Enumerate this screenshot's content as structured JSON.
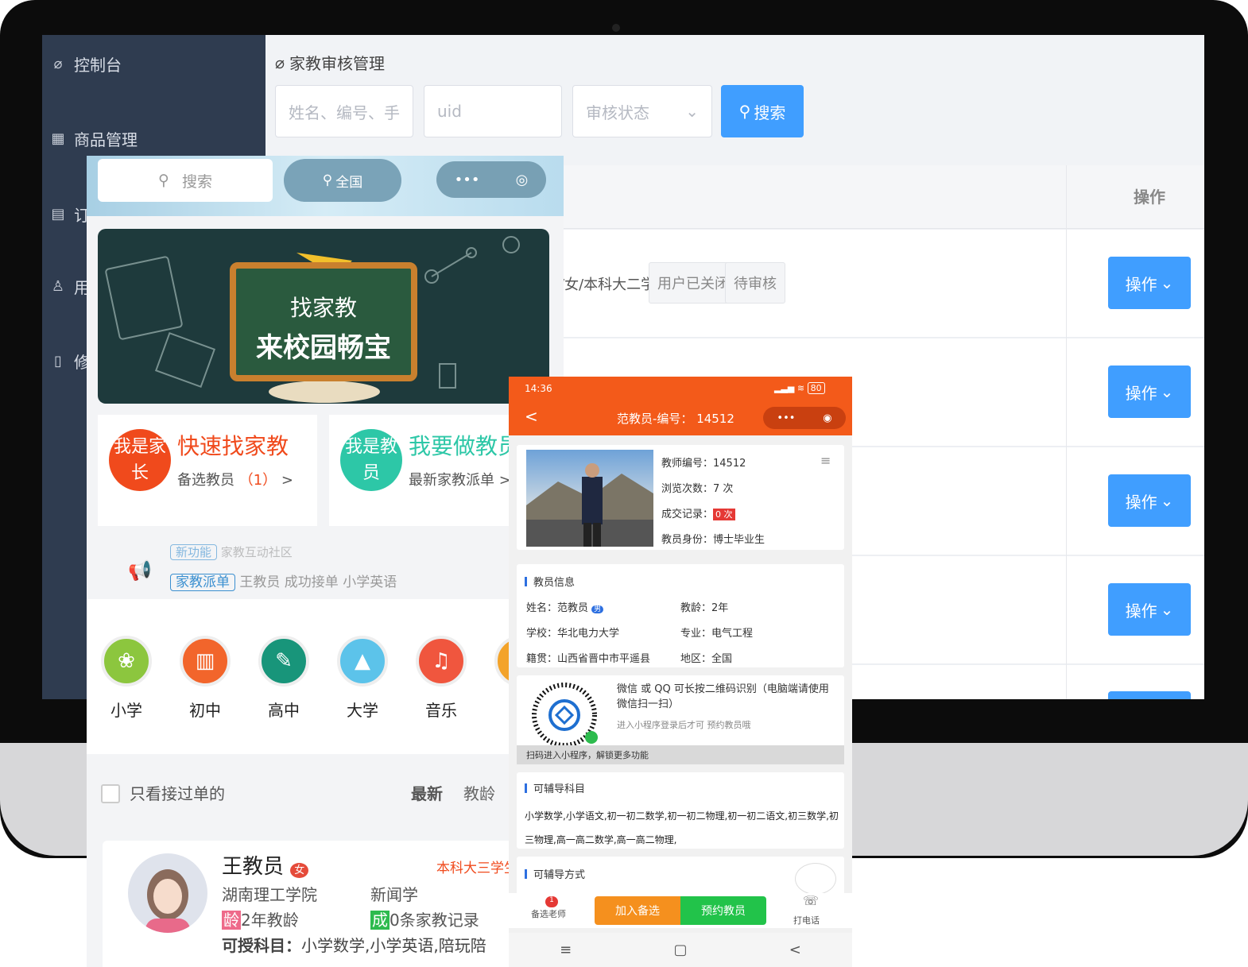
{
  "admin": {
    "sidebar": [
      "控制台",
      "商品管理",
      "订",
      "用",
      "修"
    ],
    "page_title": "家教审核管理",
    "search_placeholder": "姓名、编号、手机号",
    "uid_placeholder": "uid",
    "status_placeholder": "审核状态",
    "search_button": "搜索",
    "op_header": "操作",
    "row1_text": "/女/本科大二学生",
    "row1_tag1": "用户已关闭",
    "row1_tag2": "待审核",
    "op_button": "操作"
  },
  "left": {
    "search": "搜索",
    "region": "全国",
    "banner_line1": "找家教",
    "banner_line2": "来校园畅宝",
    "parent_badge": "我是家长",
    "parent_title": "快速找家教",
    "parent_sub": "备选教员",
    "parent_count": "（1）",
    "teacher_badge": "我是教员",
    "teacher_title": "我要做教员",
    "teacher_sub": "最新家教派单",
    "notice_tag1": "新功能",
    "notice_text1": "家教互动社区",
    "notice_tag2": "家教派单",
    "notice_text2": "王教员 成功接单 小学英语",
    "categories": [
      "小学",
      "初中",
      "高中",
      "大学",
      "音乐"
    ],
    "filter_checkbox": "只看接过单的",
    "sort_latest": "最新",
    "sort_age": "教龄",
    "teacher": {
      "name": "王教员",
      "gender": "女",
      "degree": "本科大三学生",
      "school": "湖南理工学院",
      "major": "新闻学",
      "age_badge": "龄",
      "age": "2年教龄",
      "record_badge": "成",
      "record": "0条家教记录",
      "subjects_label": "可授科目：",
      "subjects": "小学数学,小学英语,陪玩陪"
    }
  },
  "right": {
    "time": "14:36",
    "battery": "80",
    "title": "范教员-编号：",
    "number": "14512",
    "t_no_label": "教师编号：",
    "t_no": "14512",
    "views_label": "浏览次数：",
    "views": "7 次",
    "deals_label": "成交记录：",
    "deals": "0 次",
    "identity_label": "教员身份：",
    "identity": "博士毕业生",
    "info_title": "教员信息",
    "name_label": "姓名：",
    "name": "范教员",
    "gender": "男",
    "teach_label": "教龄：",
    "teach": "2年",
    "school_label": "学校：",
    "school": "华北电力大学",
    "major_label": "专业：",
    "major": "电气工程",
    "origin_label": "籍贯：",
    "origin": "山西省晋中市平遥县",
    "area_label": "地区：",
    "area": "全国",
    "qr_text": "微信 或 QQ 可长按二维码识别（电脑端请使用微信扫一扫）",
    "qr_sub": "进入小程序登录后才可 预约教员哦",
    "qr_banner": "扫码进入小程序，解锁更多功能",
    "subjects_title": "可辅导科目",
    "subjects": "小学数学,小学语文,初一初二数学,初一初二物理,初一初二语文,初三数学,初三物理,高一高二数学,高一高二物理,",
    "mode_title": "可辅导方式",
    "nav_fav": "备选老师",
    "nav_badge": "1",
    "add_btn": "加入备选",
    "book_btn": "预约教员",
    "call": "打电话"
  },
  "colors": {
    "orange": "#f35a1a",
    "blue": "#409eff",
    "admin_sidebar": "#2f3c50"
  }
}
